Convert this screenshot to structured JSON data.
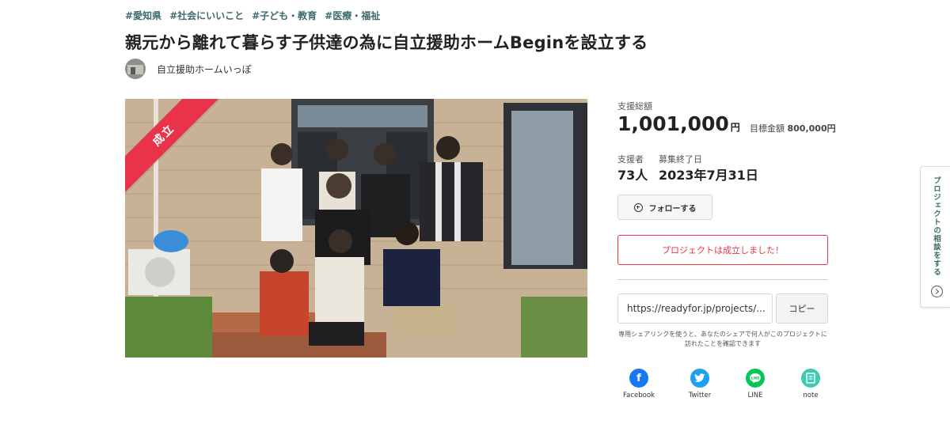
{
  "tags": [
    "#愛知県",
    "#社会にいいこと",
    "#子ども・教育",
    "#医療・福祉"
  ],
  "title": "親元から離れて暮らす子供達の為に自立援助ホームBeginを設立する",
  "owner": {
    "name": "自立援助ホームいっぽ"
  },
  "hero": {
    "badge": "成立"
  },
  "stats": {
    "total_label": "支援総額",
    "total_value": "1,001,000",
    "total_unit": "円",
    "goal_label": "目標金額",
    "goal_value": "800,000円",
    "supporters_label": "支援者",
    "supporters_value": "73人",
    "end_label": "募集終了日",
    "end_value": "2023年7月31日"
  },
  "follow_label": "フォローする",
  "success_message": "プロジェクトは成立しました！",
  "share": {
    "url": "https://readyfor.jp/projects/...",
    "copy_label": "コピー",
    "note": "専用シェアリンクを使うと、あなたのシェアで何人がこのプロジェクトに訪れたことを確認できます"
  },
  "sns": [
    {
      "label": "Facebook",
      "icon": "facebook-icon",
      "color": "#1877f2"
    },
    {
      "label": "Twitter",
      "icon": "twitter-icon",
      "color": "#1da1f2"
    },
    {
      "label": "LINE",
      "icon": "line-icon",
      "color": "#06c755"
    },
    {
      "label": "note",
      "icon": "note-icon",
      "color": "#41c9b4"
    }
  ],
  "consult_tab": "プロジェクトの相談をする",
  "colors": {
    "accent": "#e8334a",
    "tag": "#3d6b6b"
  }
}
